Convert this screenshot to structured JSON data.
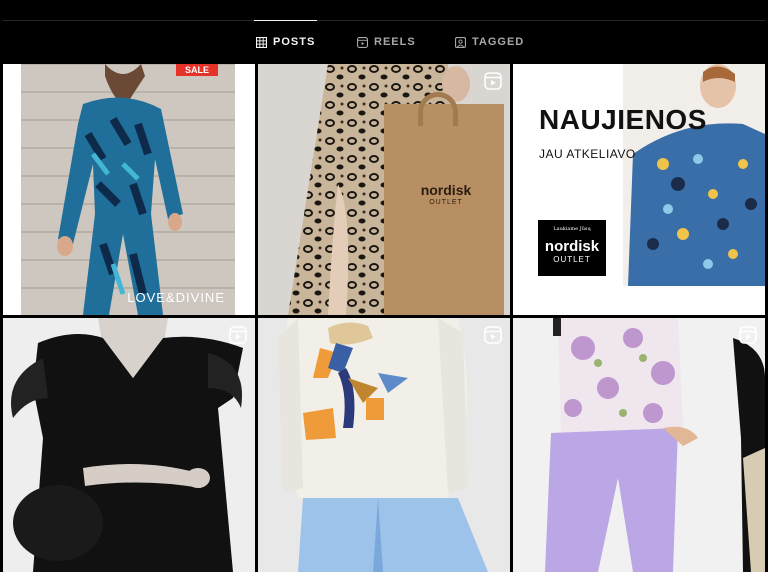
{
  "tabs": [
    {
      "label": "POSTS",
      "icon": "grid-icon",
      "active": true
    },
    {
      "label": "REELS",
      "icon": "reels-icon",
      "active": false
    },
    {
      "label": "TAGGED",
      "icon": "tagged-icon",
      "active": false
    }
  ],
  "posts": [
    {
      "type": "photo",
      "sale_badge": "SALE",
      "watermark": "LOVE&DIVINE"
    },
    {
      "type": "reel",
      "bag_logo": "nordisk",
      "bag_logo_sub": "OUTLET"
    },
    {
      "type": "photo",
      "headline": "NAUJIENOS",
      "subheadline": "JAU ATKELIAVO",
      "badge_top": "Laukiame Jūsų",
      "badge_logo": "nordisk",
      "badge_sub": "OUTLET"
    },
    {
      "type": "reel"
    },
    {
      "type": "reel"
    },
    {
      "type": "reel"
    }
  ],
  "colors": {
    "background": "#000000",
    "tab_active": "#f5f5f5",
    "tab_inactive": "#a8a8a8",
    "sale_red": "#e6332a"
  }
}
